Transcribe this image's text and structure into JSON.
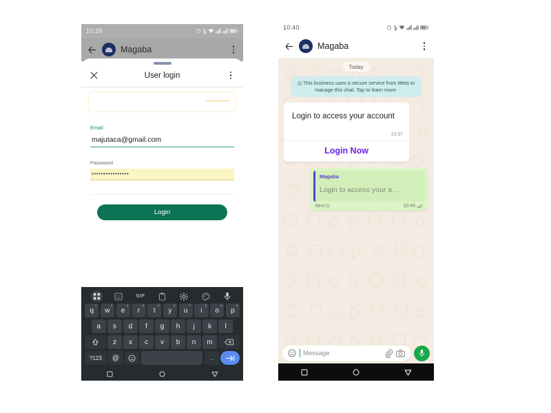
{
  "left_phone": {
    "status_bar": {
      "time": "10:39",
      "icons": [
        "alarm-icon",
        "bluetooth-icon",
        "wifi-icon",
        "signal-icon",
        "signal-icon",
        "battery-icon"
      ]
    },
    "app_header": {
      "back": "back-arrow-icon",
      "avatar": "contact-avatar",
      "title": "Magaba",
      "menu": "overflow-menu-icon"
    },
    "sheet": {
      "close": "close-icon",
      "title": "User login",
      "menu": "overflow-menu-icon",
      "fields": [
        {
          "label": "Email",
          "value": "majutaca@gmail.com",
          "autofilled": false
        },
        {
          "label": "Password",
          "value": "••••••••••••••••",
          "autofilled": true
        }
      ],
      "submit_label": "Login"
    },
    "keyboard": {
      "toolbar": [
        "apps-grid-icon",
        "sticker-icon",
        "GIF",
        "clipboard-icon",
        "gear-icon",
        "palette-icon",
        "microphone-icon"
      ],
      "row1": [
        {
          "k": "q",
          "n": "1"
        },
        {
          "k": "w",
          "n": "2"
        },
        {
          "k": "e",
          "n": "3"
        },
        {
          "k": "r",
          "n": "4"
        },
        {
          "k": "t",
          "n": "5"
        },
        {
          "k": "y",
          "n": "6"
        },
        {
          "k": "u",
          "n": "7"
        },
        {
          "k": "i",
          "n": "8"
        },
        {
          "k": "o",
          "n": "9"
        },
        {
          "k": "p",
          "n": "0"
        }
      ],
      "row2": [
        "a",
        "s",
        "d",
        "f",
        "g",
        "h",
        "j",
        "k",
        "l"
      ],
      "row3": [
        "z",
        "x",
        "c",
        "v",
        "b",
        "n",
        "m"
      ],
      "shift_key": "shift-icon",
      "backspace_key": "backspace-icon",
      "symbols_key": "?123",
      "at_key": "@",
      "emoji_key": "emoji-icon",
      "space_key": "",
      "period_key": ".",
      "enter_key": "next-field-icon"
    },
    "nav_bar": [
      "recents-square-icon",
      "home-circle-icon",
      "back-triangle-icon"
    ]
  },
  "right_phone": {
    "status_bar": {
      "time": "10:40",
      "icons": [
        "alarm-icon",
        "bluetooth-icon",
        "wifi-icon",
        "signal-icon",
        "signal-icon",
        "battery-icon"
      ]
    },
    "app_header": {
      "back": "back-arrow-icon",
      "avatar": "contact-avatar",
      "title": "Magaba",
      "menu": "overflow-menu-icon"
    },
    "chat": {
      "day_divider": "Today",
      "system_notice": "This business uses a secure service from Meta to manage this chat. Tap to learn more.",
      "incoming_card": {
        "text": "Login to access your account",
        "time": "10:37",
        "action_label": "Login Now",
        "action_color": "#6b22e8"
      },
      "outgoing_bubble": {
        "quote_name": "Magaba",
        "quote_text": "Login to access your a…",
        "status_label": "Sent",
        "time": "10:40",
        "ticks": "double-check-icon"
      }
    },
    "input_bar": {
      "emoji": "emoji-icon",
      "placeholder": "Message",
      "attach": "paperclip-icon",
      "camera": "camera-icon",
      "mic": "microphone-icon",
      "mic_color": "#19a84c"
    },
    "nav_bar": [
      "recents-square-icon",
      "home-circle-icon",
      "back-triangle-icon"
    ]
  }
}
